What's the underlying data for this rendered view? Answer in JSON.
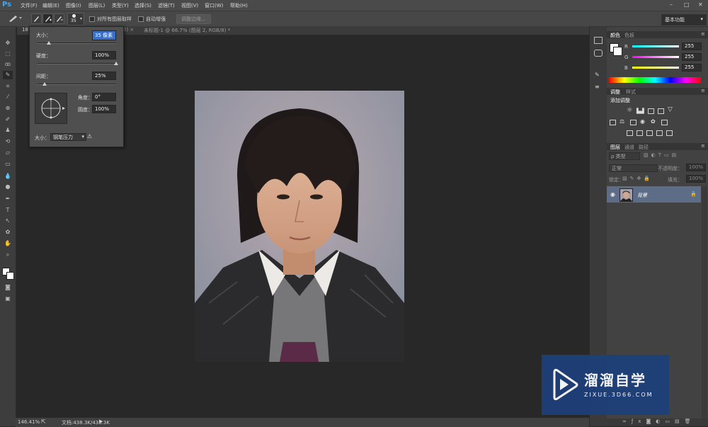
{
  "app": {
    "logo": "Ps"
  },
  "menu": {
    "items": [
      "文件(F)",
      "编辑(E)",
      "图像(I)",
      "图层(L)",
      "类型(Y)",
      "选择(S)",
      "滤镜(T)",
      "视图(V)",
      "窗口(W)",
      "帮助(H)"
    ]
  },
  "window_controls": {
    "minimize": "–",
    "maximize": "□",
    "close": "✕"
  },
  "options": {
    "brush_size": "35",
    "sample_all_layers_label": "对所有图层取样",
    "auto_enhance_label": "自动增强",
    "refine_edge_label": "调整边缘...",
    "workspace": "基本功能"
  },
  "tabs": {
    "tab1_prefix": "18",
    "tab1_suffix": "8) ×",
    "tab2": "未标题-1 @ 66.7% (图层 2, RGB/8) *",
    "tab2_close": "×"
  },
  "brush_popup": {
    "size_label": "大小：",
    "size_value": "35 像素",
    "hardness_label": "硬度：",
    "hardness_value": "100%",
    "spacing_label": "间距：",
    "spacing_value": "25%",
    "angle_label": "角度：",
    "angle_value": "0°",
    "roundness_label": "圆度：",
    "roundness_value": "100%",
    "size_control_label": "大小：",
    "size_control_value": "钢笔压力",
    "hardness_fraction": 1.0,
    "spacing_fraction": 0.1,
    "size_fraction": 0.15
  },
  "color_panel": {
    "tab_color": "颜色",
    "tab_swatches": "色板",
    "r_label": "R",
    "g_label": "G",
    "b_label": "B",
    "r_value": "255",
    "g_value": "255",
    "b_value": "255"
  },
  "adjustments_panel": {
    "tab_adjust": "调整",
    "tab_styles": "样式",
    "add_label": "添加调整"
  },
  "layers_panel": {
    "tab_layers": "图层",
    "tab_channels": "通道",
    "tab_paths": "路径",
    "filter_kind": "ρ 类型",
    "blend_mode": "正常",
    "opacity_label": "不透明度：",
    "opacity_value": "100%",
    "lock_label": "锁定：",
    "fill_label": "填充：",
    "fill_value": "100%",
    "layer_name": "背景"
  },
  "status": {
    "zoom": "146.41%",
    "doc_info": "文档:438.3K/438.3K"
  },
  "watermark": {
    "title": "溜溜自学",
    "url": "ZIXUE.3D66.COM"
  },
  "colors": {
    "accent_blue": "#4aa3e8",
    "layer_selected": "#5e6d87",
    "watermark_bg": "#1e3f7a"
  }
}
